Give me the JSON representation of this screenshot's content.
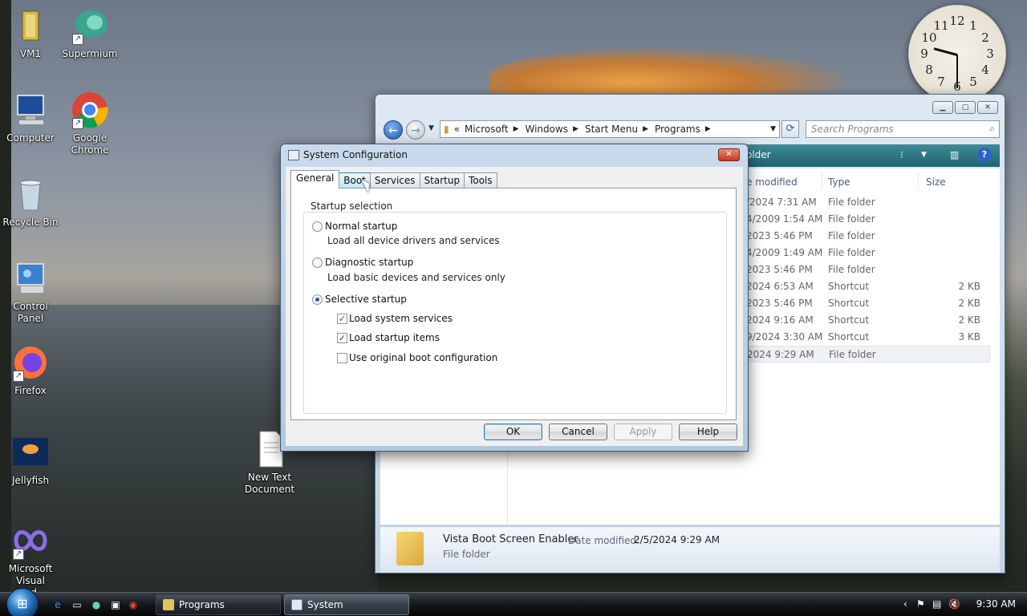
{
  "desktop": {
    "icons": [
      {
        "label": "VM1"
      },
      {
        "label": "Supermium"
      },
      {
        "label": "Computer"
      },
      {
        "label": "Google Chrome"
      },
      {
        "label": "Recycle Bin"
      },
      {
        "label": "Control Panel"
      },
      {
        "label": "Firefox"
      },
      {
        "label": "Jellyfish"
      },
      {
        "label": "New Text Document"
      },
      {
        "label": "Microsoft Visual Stud..."
      }
    ]
  },
  "clock": {
    "numbers": [
      "12",
      "1",
      "2",
      "3",
      "4",
      "5",
      "6",
      "7",
      "8",
      "9",
      "10",
      "11"
    ],
    "time": "9:30"
  },
  "explorer": {
    "address": {
      "overflow": "«",
      "segments": [
        "Microsoft",
        "Windows",
        "Start Menu",
        "Programs"
      ]
    },
    "search_placeholder": "Search Programs",
    "toolbar_label": "older",
    "columns": [
      "e modified",
      "Type",
      "Size"
    ],
    "rows": [
      {
        "date": "/2024 7:31 AM",
        "type": "File folder",
        "size": ""
      },
      {
        "date": "4/2009 1:54 AM",
        "type": "File folder",
        "size": ""
      },
      {
        "date": "2023 5:46 PM",
        "type": "File folder",
        "size": ""
      },
      {
        "date": "4/2009 1:49 AM",
        "type": "File folder",
        "size": ""
      },
      {
        "date": "2023 5:46 PM",
        "type": "File folder",
        "size": ""
      },
      {
        "date": "2024 6:53 AM",
        "type": "Shortcut",
        "size": "2 KB"
      },
      {
        "date": "2023 5:46 PM",
        "type": "Shortcut",
        "size": "2 KB"
      },
      {
        "date": "2024 9:16 AM",
        "type": "Shortcut",
        "size": "2 KB"
      },
      {
        "date": "9/2024 3:30 AM",
        "type": "Shortcut",
        "size": "3 KB"
      },
      {
        "date": "2024 9:29 AM",
        "type": "File folder",
        "size": ""
      }
    ],
    "details": {
      "name": "Vista Boot Screen Enabler",
      "date_label": "Date modified:",
      "date_value": "2/5/2024 9:29 AM",
      "kind": "File folder"
    }
  },
  "dialog": {
    "title": "System Configuration",
    "tabs": [
      "General",
      "Boot",
      "Services",
      "Startup",
      "Tools"
    ],
    "group_title": "Startup selection",
    "options": {
      "normal": {
        "label": "Normal startup",
        "desc": "Load all device drivers and services"
      },
      "diagnostic": {
        "label": "Diagnostic startup",
        "desc": "Load basic devices and services only"
      },
      "selective": {
        "label": "Selective startup"
      }
    },
    "checks": {
      "system_services": "Load system services",
      "startup_items": "Load startup items",
      "original_boot": "Use original boot configuration"
    },
    "buttons": {
      "ok": "OK",
      "cancel": "Cancel",
      "apply": "Apply",
      "help": "Help"
    }
  },
  "taskbar": {
    "programs_label": "Programs",
    "sysconfig_label": "System Configuration",
    "time": "9:30 AM"
  }
}
